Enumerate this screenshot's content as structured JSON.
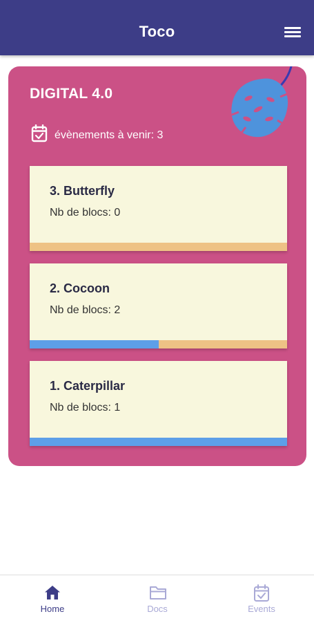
{
  "header": {
    "title": "Toco",
    "menu_icon": "hamburger-menu-icon"
  },
  "group": {
    "title": "DIGITAL 4.0",
    "events_label": "évènements à venir: 3",
    "decoration": "monstera-leaf-icon"
  },
  "phases": [
    {
      "name": "3. Butterfly",
      "blocks_label": "Nb de blocs: 0",
      "progress_fraction": 0.0
    },
    {
      "name": "2. Cocoon",
      "blocks_label": "Nb de blocs: 2",
      "progress_fraction": 0.5
    },
    {
      "name": "1. Caterpillar",
      "blocks_label": "Nb de blocs: 1",
      "progress_fraction": 1.0
    }
  ],
  "nav": [
    {
      "label": "Home",
      "icon": "home-icon",
      "active": true
    },
    {
      "label": "Docs",
      "icon": "folder-icon",
      "active": false
    },
    {
      "label": "Events",
      "icon": "calendar-check-icon",
      "active": false
    }
  ],
  "colors": {
    "header_bg": "#3d3d87",
    "card_bg": "#cb5186",
    "phase_bg": "#f8f7dd",
    "progress_fill": "#5d9fe8",
    "progress_track": "#eec285",
    "nav_active": "#3d3d87",
    "nav_inactive": "#a9a9d6"
  }
}
